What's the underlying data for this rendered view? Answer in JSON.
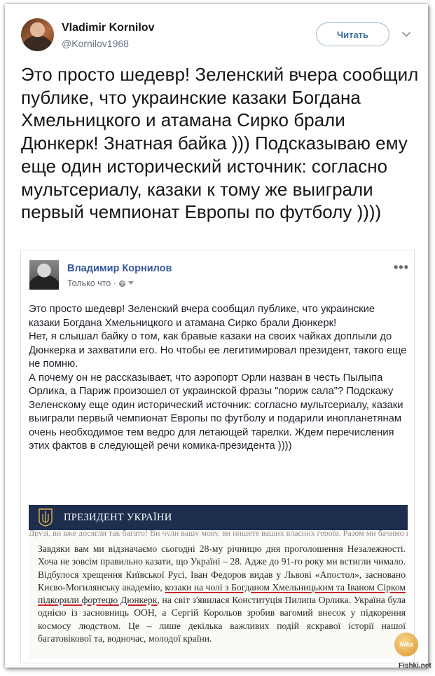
{
  "tweet": {
    "author_name": "Vladimir Kornilov",
    "author_handle": "@Kornilov1968",
    "follow_label": "Читать",
    "text": "Это просто шедевр! Зеленский вчера сообщил публике, что украинские казаки Богдана Хмельницкого и атамана Сирко брали Дюнкерк! Знатная байка ))) Подсказываю ему еще один исторический источник: согласно мультсериалу, казаки к тому же выиграли первый чемпионат Европы по футболу ))))"
  },
  "fb_post": {
    "author_name": "Владимир Корнилов",
    "time_label": "Только что ·",
    "more_label": "•••",
    "paragraphs": [
      "Это просто шедевр! Зеленский вчера сообщил публике, что украинские казаки Богдана Хмельницкого и атамана Сирко брали Дюнкерк!",
      "Нет, я слышал байку о том, как бравые казаки на своих чайках доплыли до Дюнкерка и захватили его. Но чтобы ее легитимировал президент, такого еще не помню.",
      "А почему он не рассказывает, что аэропорт Орли назван в честь Пылыпа Орлика, а Париж произошел от украинской фразы \"пориж сала\"? Подскажу Зеленскому еще один исторический источник: согласно мультсериалу, казаки выиграли первый чемпионат Европы по футболу и подарили инопланетянам очень необходимое тем ведро для летающей тарелки. Ждем перечисления этих фактов в следующей речи комика-президента ))))"
    ]
  },
  "decree": {
    "header": "ПРЕЗИДЕНТ УКРАЇНИ",
    "strip_text": "Друзі, ви вже досягли так багато! Ви чули вашу мову, ви пишете ваших власних героїв. Разом ми бачимо вашу волю.",
    "text_before": "Завдяки вам ми відзначаємо сьогодні 28-му річницю дня проголошення Незалежності. Хоча не зовсім правильно казати, що Україні – 28. Адже до 91-го року ми встигли чимало. Відбулося хрещення Київської Русі, Іван Федоров видав у Львові «Апостол», засновано Києво-Могилянську академію, ",
    "text_underlined": "козаки на чолі з Богданом Хмельницьким та Іваном Сірком підкорили фортецю Дюнкерк",
    "text_after": ", на світ з'явилася Конституція Пилипа Орлика. Україна була однією із засновниць ООН, а Сергій Корольов зробив вагомий внесок у підкорення космосу людством. Це – лише декілька важливих подій яскравої історії нашої багатовікової та, водночас, молодої країни."
  },
  "watermark": {
    "badge": "Nika",
    "site": "Fishki.net"
  },
  "colors": {
    "link_blue": "#385898",
    "follow_text": "#3b6f99",
    "decree_bar": "#1e2e4f",
    "underline_red": "#c8242b"
  }
}
